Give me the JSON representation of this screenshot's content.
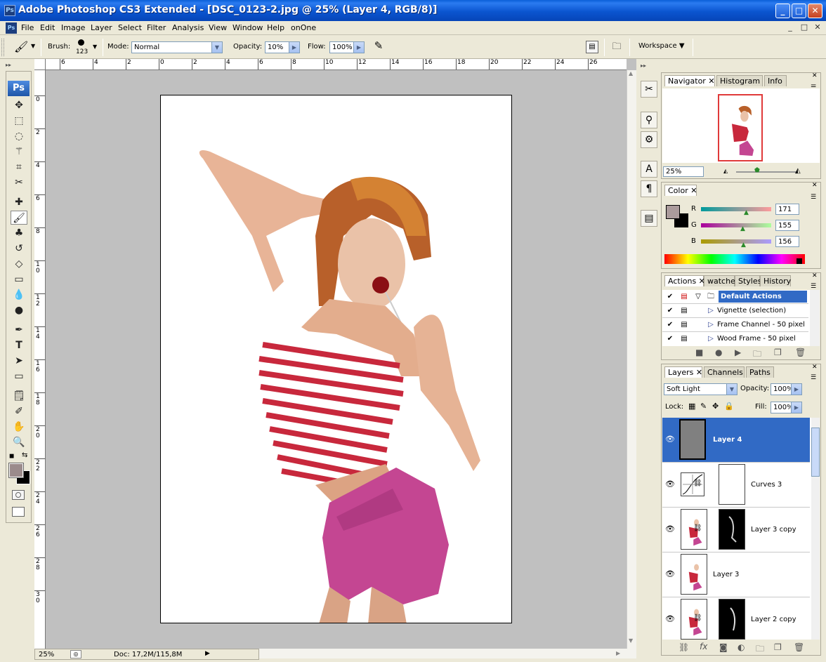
{
  "app": {
    "ps_badge": "Ps",
    "title": "Adobe Photoshop CS3 Extended - [DSC_0123-2.jpg @ 25% (Layer 4, RGB/8)]",
    "window_buttons": [
      "_",
      "□",
      "✕"
    ]
  },
  "menu": {
    "items": [
      "File",
      "Edit",
      "Image",
      "Layer",
      "Select",
      "Filter",
      "Analysis",
      "View",
      "Window",
      "Help",
      "onOne"
    ],
    "doc_controls": [
      "_",
      "□",
      "✕"
    ]
  },
  "options": {
    "brush_label": "Brush:",
    "brush_size": "123",
    "mode_label": "Mode:",
    "mode_value": "Normal",
    "opacity_label": "Opacity:",
    "opacity_value": "10%",
    "flow_label": "Flow:",
    "flow_value": "100%",
    "workspace_label": "Workspace ▼"
  },
  "toolbox": {
    "ps_logo": "Ps",
    "tools": [
      "move-icon",
      "marquee-icon",
      "lasso-icon",
      "magic-wand-icon",
      "crop-icon",
      "slice-icon",
      "healing-icon",
      "brush-icon",
      "clone-stamp-icon",
      "history-brush-icon",
      "eraser-icon",
      "gradient-icon",
      "blur-icon",
      "dodge-icon",
      "pen-icon",
      "type-icon",
      "path-select-icon",
      "shape-icon",
      "notes-icon",
      "eyedropper-icon",
      "hand-icon",
      "zoom-icon"
    ],
    "foreground_color": "#9b8b8c",
    "background_color": "#000000"
  },
  "rulers": {
    "top": [
      "6",
      "4",
      "2",
      "0",
      "2",
      "4",
      "6",
      "8",
      "10",
      "12",
      "14",
      "16",
      "18",
      "20",
      "22",
      "24",
      "26"
    ],
    "left": [
      "0",
      "2",
      "4",
      "6",
      "8",
      "1 0",
      "1 2",
      "1 4",
      "1 6",
      "1 8",
      "2 0",
      "2 2",
      "2 4",
      "2 6",
      "2 8",
      "3 0"
    ]
  },
  "status": {
    "zoom": "25%",
    "doc": "Doc: 17,2M/115,8M"
  },
  "navigator": {
    "tabs": [
      "Navigator",
      "Histogram",
      "Info"
    ],
    "zoom": "25%"
  },
  "color_panel": {
    "tabs": [
      "Color"
    ],
    "r_label": "R",
    "r_value": "171",
    "g_label": "G",
    "g_value": "155",
    "b_label": "B",
    "b_value": "156",
    "swatch": "#ab9b9c"
  },
  "actions_panel": {
    "tabs": [
      "Actions",
      "watches",
      "Styles",
      "History"
    ],
    "rows": [
      "Default Actions",
      "Vignette (selection)",
      "Frame Channel - 50 pixel",
      "Wood Frame - 50 pixel"
    ]
  },
  "layers_panel": {
    "tabs": [
      "Layers",
      "Channels",
      "Paths"
    ],
    "blend_mode": "Soft Light",
    "opacity_label": "Opacity:",
    "opacity_value": "100%",
    "lock_label": "Lock:",
    "fill_label": "Fill:",
    "fill_value": "100%",
    "layers": [
      "Layer 4",
      "Curves 3",
      "Layer 3 copy",
      "Layer 3",
      "Layer 2 copy"
    ]
  }
}
